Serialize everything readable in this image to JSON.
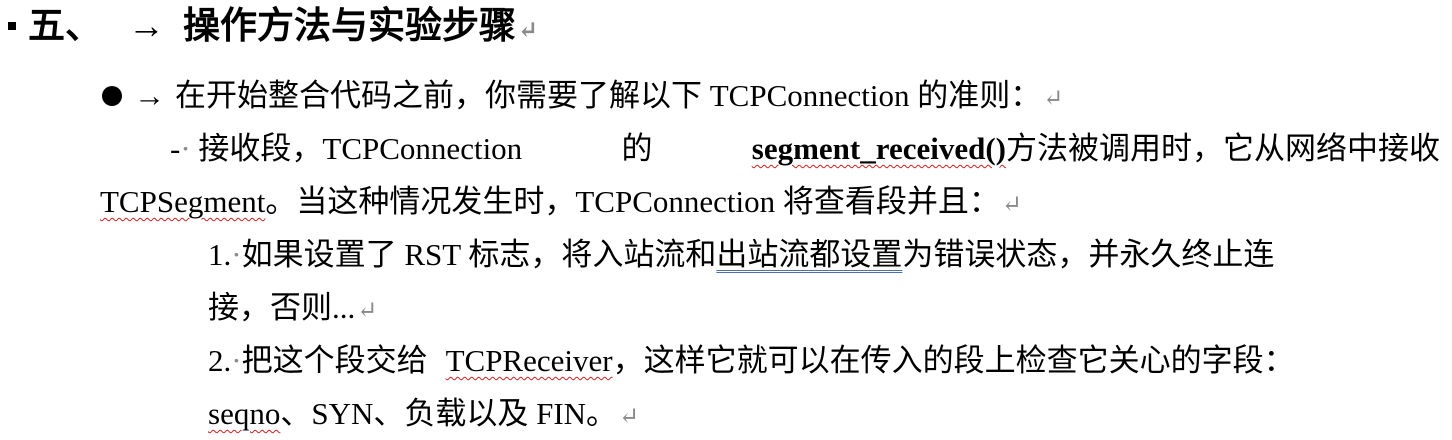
{
  "heading": {
    "number": "五、",
    "arrow": "→",
    "title": "操作方法与实验步骤"
  },
  "bullet1": {
    "arrow": "→",
    "text": "在开始整合代码之前，你需要了解以下 TCPConnection 的准则："
  },
  "rule1": {
    "dash": "-",
    "part1": "接收段，TCPConnection",
    "part2": "的",
    "method": "segment_received()",
    "part3": "方法被调用时，它从网络中接收",
    "line2_term": "TCPSegment",
    "line2_rest": "。当这种情况发生时，TCPConnection 将查看段并且："
  },
  "step1": {
    "num": "1.",
    "part1": "如果设置了 RST 标志，将入站流和",
    "underlined": "出站流都设置",
    "part2": "为错误状态，并永久终止连",
    "line2": "接，否则..."
  },
  "step2": {
    "num": "2.",
    "part1": "把这个段交给",
    "term": "TCPReceiver",
    "part2": "，这样它就可以在传入的段上检查它关心的字段：",
    "line2_term": "seqno",
    "line2_rest": "、SYN、负载以及 FIN。"
  },
  "marks": {
    "para": "↵",
    "space": "·"
  }
}
